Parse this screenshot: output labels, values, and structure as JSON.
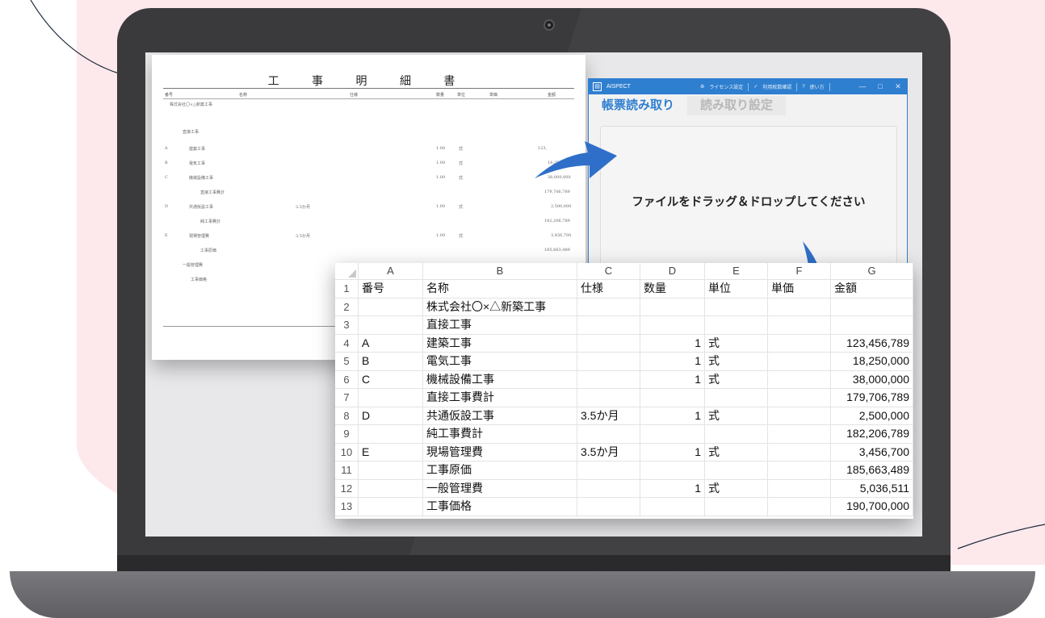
{
  "colors": {
    "accent": "#2f7fd0",
    "background_blob": "#fde8ec",
    "laptop": "#3a3a3d",
    "arrow": "#2f6fc9"
  },
  "paper": {
    "title": "工 事 明 細 書",
    "headers": [
      "番号",
      "名称",
      "仕様",
      "数量",
      "単位",
      "単価",
      "金額"
    ],
    "rows": [
      {
        "no": "",
        "name": "株式会社〇×△新築工事",
        "spec": "",
        "qty": "",
        "unit": "",
        "amount": ""
      },
      {
        "no": "",
        "name": "直接工事",
        "spec": "",
        "qty": "",
        "unit": "",
        "amount": ""
      },
      {
        "no": "A",
        "name": "建築工事",
        "spec": "",
        "qty": "1.00",
        "unit": "式",
        "amount": "123,"
      },
      {
        "no": "B",
        "name": "電気工事",
        "spec": "",
        "qty": "1.00",
        "unit": "式",
        "amount": "18,250,000"
      },
      {
        "no": "C",
        "name": "機械設備工事",
        "spec": "",
        "qty": "1.00",
        "unit": "式",
        "amount": "38,000,000"
      },
      {
        "no": "",
        "name": "直接工事費計",
        "spec": "",
        "qty": "",
        "unit": "",
        "amount": "179,706,789"
      },
      {
        "no": "D",
        "name": "共通仮設工事",
        "spec": "3.5か月",
        "qty": "1.00",
        "unit": "式",
        "amount": "2,500,000"
      },
      {
        "no": "",
        "name": "純工事費計",
        "spec": "",
        "qty": "",
        "unit": "",
        "amount": "182,206,789"
      },
      {
        "no": "E",
        "name": "現場管理費",
        "spec": "3.5か月",
        "qty": "1.00",
        "unit": "式",
        "amount": "3,456,700"
      },
      {
        "no": "",
        "name": "工事原価",
        "spec": "",
        "qty": "",
        "unit": "",
        "amount": "185,663,489"
      },
      {
        "no": "",
        "name": "一般管理費",
        "spec": "",
        "qty": "",
        "unit": "",
        "amount": ""
      },
      {
        "no": "",
        "name": "工事価格",
        "spec": "",
        "qty": "",
        "unit": "",
        "amount": ""
      }
    ]
  },
  "app": {
    "title": "AISPECT",
    "toolbar": {
      "license_label": "ライセンス設定",
      "usage_label": "利用枚数確認",
      "help_label": "使い方"
    },
    "window_controls": {
      "minimize": "—",
      "maximize": "□",
      "close": "✕"
    },
    "tabs": [
      {
        "label": "帳票読み取り",
        "active": true
      },
      {
        "label": "読み取り設定",
        "active": false
      }
    ],
    "dropzone_text": "ファイルをドラッグ＆ドロップしてください"
  },
  "sheet": {
    "columns": [
      "A",
      "B",
      "C",
      "D",
      "E",
      "F",
      "G"
    ],
    "rows": [
      {
        "n": "1",
        "cells": [
          "番号",
          "名称",
          "仕様",
          "数量",
          "単位",
          "単価",
          "金額"
        ]
      },
      {
        "n": "2",
        "cells": [
          "",
          "株式会社〇×△新築工事",
          "",
          "",
          "",
          "",
          ""
        ]
      },
      {
        "n": "3",
        "cells": [
          "",
          "直接工事",
          "",
          "",
          "",
          "",
          ""
        ]
      },
      {
        "n": "4",
        "cells": [
          "A",
          "建築工事",
          "",
          "1",
          "式",
          "",
          "123,456,789"
        ]
      },
      {
        "n": "5",
        "cells": [
          "B",
          "電気工事",
          "",
          "1",
          "式",
          "",
          "18,250,000"
        ]
      },
      {
        "n": "6",
        "cells": [
          "C",
          "機械設備工事",
          "",
          "1",
          "式",
          "",
          "38,000,000"
        ]
      },
      {
        "n": "7",
        "cells": [
          "",
          "直接工事費計",
          "",
          "",
          "",
          "",
          "179,706,789"
        ]
      },
      {
        "n": "8",
        "cells": [
          "D",
          "共通仮設工事",
          "3.5か月",
          "1",
          "式",
          "",
          "2,500,000"
        ]
      },
      {
        "n": "9",
        "cells": [
          "",
          "純工事費計",
          "",
          "",
          "",
          "",
          "182,206,789"
        ]
      },
      {
        "n": "10",
        "cells": [
          "E",
          "現場管理費",
          "3.5か月",
          "1",
          "式",
          "",
          "3,456,700"
        ]
      },
      {
        "n": "11",
        "cells": [
          "",
          "工事原価",
          "",
          "",
          "",
          "",
          "185,663,489"
        ]
      },
      {
        "n": "12",
        "cells": [
          "",
          "一般管理費",
          "",
          "1",
          "式",
          "",
          "5,036,511"
        ]
      },
      {
        "n": "13",
        "cells": [
          "",
          "工事価格",
          "",
          "",
          "",
          "",
          "190,700,000"
        ]
      }
    ]
  }
}
